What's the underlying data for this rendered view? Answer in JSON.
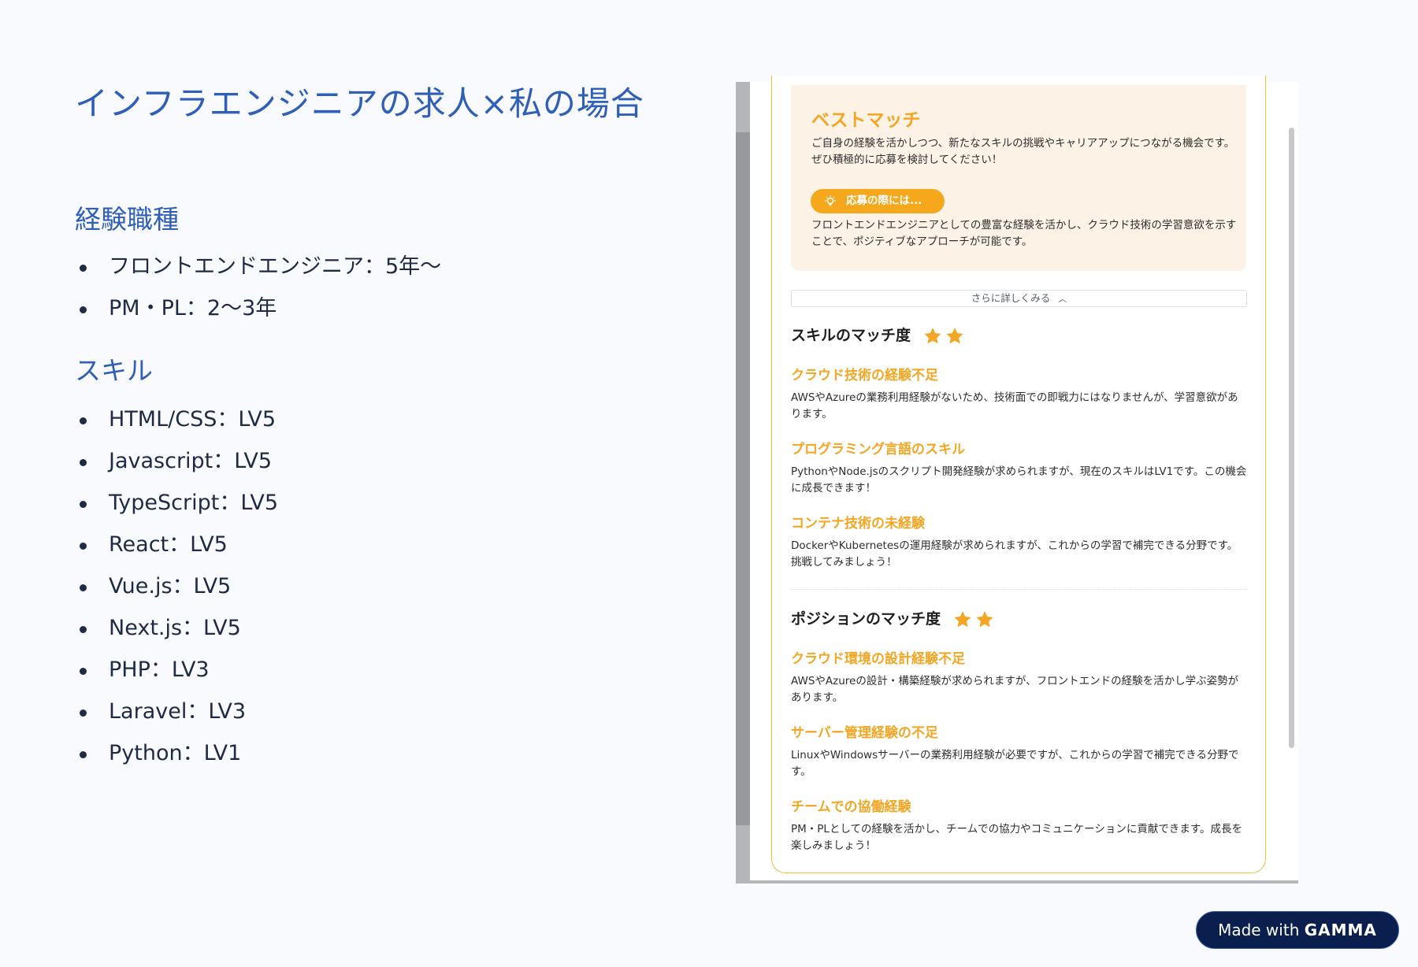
{
  "page": {
    "title": "インフラエンジニアの求人×私の場合",
    "sections": {
      "experience": {
        "heading": "経験職種",
        "items": [
          "フロントエンドエンジニア：5年〜",
          "PM・PL：2〜3年"
        ]
      },
      "skills": {
        "heading": "スキル",
        "items": [
          "HTML/CSS：LV5",
          "Javascript：LV5",
          "TypeScript：LV5",
          "React：LV5",
          "Vue.js：LV5",
          "Next.js：LV5",
          "PHP：LV3",
          "Laravel：LV3",
          "Python：LV1"
        ]
      }
    }
  },
  "screenshot": {
    "best_match": {
      "title": "ベストマッチ",
      "description": "ご自身の経験を活かしつつ、新たなスキルの挑戦やキャリアアップにつながる機会です。ぜひ積極的に応募を検討してください！",
      "apply_pill": "応募の際には...",
      "apply_text": "フロントエンドエンジニアとしての豊富な経験を活かし、クラウド技術の学習意欲を示すことで、ポジティブなアプローチが可能です。"
    },
    "more_button": "さらに詳しくみる",
    "skill_match": {
      "heading": "スキルのマッチ度",
      "stars": 2,
      "items": [
        {
          "title": "クラウド技術の経験不足",
          "desc": "AWSやAzureの業務利用経験がないため、技術面での即戦力にはなりませんが、学習意欲があります。"
        },
        {
          "title": "プログラミング言語のスキル",
          "desc": "PythonやNode.jsのスクリプト開発経験が求められますが、現在のスキルはLV1です。この機会に成長できます！"
        },
        {
          "title": "コンテナ技術の未経験",
          "desc": "DockerやKubernetesの運用経験が求められますが、これからの学習で補完できる分野です。挑戦してみましょう！"
        }
      ]
    },
    "position_match": {
      "heading": "ポジションのマッチ度",
      "stars": 2,
      "items": [
        {
          "title": "クラウド環境の設計経験不足",
          "desc": "AWSやAzureの設計・構築経験が求められますが、フロントエンドの経験を活かし学ぶ姿勢があります。"
        },
        {
          "title": "サーバー管理経験の不足",
          "desc": "LinuxやWindowsサーバーの業務利用経験が必要ですが、これからの学習で補完できる分野です。"
        },
        {
          "title": "チームでの協働経験",
          "desc": "PM・PLとしての経験を活かし、チームでの協力やコミュニケーションに貢献できます。成長を楽しみましょう！"
        }
      ]
    }
  },
  "badge": {
    "made_with": "Made with",
    "brand": "GAMMA"
  },
  "colors": {
    "title_blue": "#2f5fb8",
    "accent_orange": "#f3a623",
    "badge_navy": "#0b1f4f"
  }
}
